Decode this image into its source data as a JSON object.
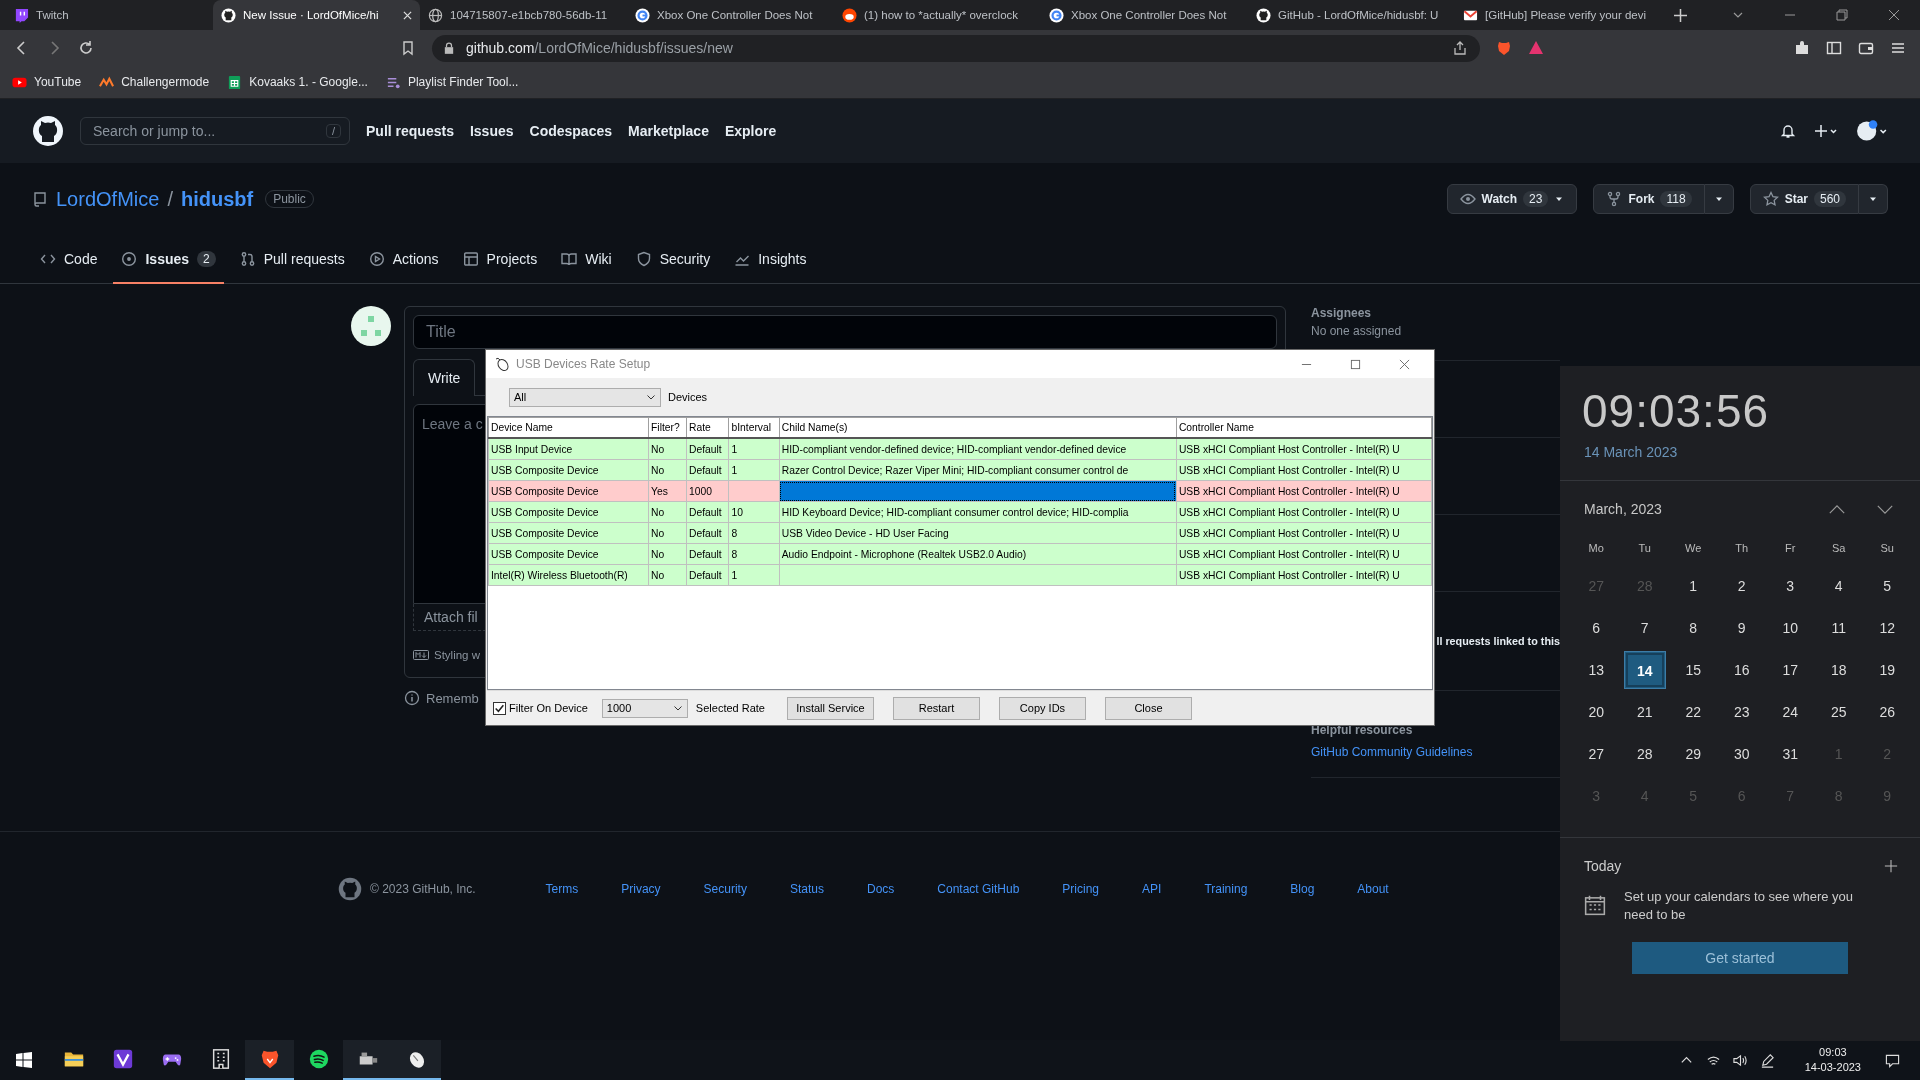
{
  "browser": {
    "tabs": [
      {
        "title": "Twitch",
        "selected": false
      },
      {
        "title": "New Issue · LordOfMice/hi",
        "selected": true
      },
      {
        "title": "104715807-e1bcb780-56db-11",
        "selected": false
      },
      {
        "title": "Xbox One Controller Does Not",
        "selected": false
      },
      {
        "title": "(1) how to *actually* overclock",
        "selected": false
      },
      {
        "title": "Xbox One Controller Does Not",
        "selected": false
      },
      {
        "title": "GitHub - LordOfMice/hidusbf: U",
        "selected": false
      },
      {
        "title": "[GitHub] Please verify your devi",
        "selected": false
      }
    ],
    "address": {
      "host": "github.com",
      "path": "/LordOfMice/hidusbf/issues/new"
    },
    "bookmarks": [
      "YouTube",
      "Challengermode",
      "Kovaaks 1. - Google...",
      "Playlist Finder Tool..."
    ]
  },
  "github": {
    "search_placeholder": "Search or jump to...",
    "search_key": "/",
    "nav": [
      "Pull requests",
      "Issues",
      "Codespaces",
      "Marketplace",
      "Explore"
    ],
    "repo": {
      "owner": "LordOfMice",
      "separator": "/",
      "name": "hidusbf",
      "visibility": "Public"
    },
    "actions": [
      {
        "label": "Watch",
        "count": "23",
        "kind": "watch"
      },
      {
        "label": "Fork",
        "count": "118",
        "kind": "fork"
      },
      {
        "label": "Star",
        "count": "560",
        "kind": "star"
      }
    ],
    "tabs": [
      {
        "label": "Code",
        "selected": false
      },
      {
        "label": "Issues",
        "count": "2",
        "selected": true
      },
      {
        "label": "Pull requests",
        "selected": false
      },
      {
        "label": "Actions",
        "selected": false
      },
      {
        "label": "Projects",
        "selected": false
      },
      {
        "label": "Wiki",
        "selected": false
      },
      {
        "label": "Security",
        "selected": false
      },
      {
        "label": "Insights",
        "selected": false
      }
    ],
    "form": {
      "title_placeholder": "Title",
      "write_tab": "Write",
      "comment_placeholder": "Leave a c",
      "attach": "Attach fil",
      "styling": "Styling w",
      "remember": "Rememb"
    },
    "sidebar": {
      "assignees_heading": "Assignees",
      "assignees_value": "No one assigned",
      "linked_note": "ll requests linked to this",
      "resources_heading": "Helpful resources",
      "resources_link": "GitHub Community Guidelines"
    },
    "footer": {
      "copyright": "© 2023 GitHub, Inc.",
      "links": [
        "Terms",
        "Privacy",
        "Security",
        "Status",
        "Docs",
        "Contact GitHub",
        "Pricing",
        "API",
        "Training",
        "Blog",
        "About"
      ]
    }
  },
  "usb_dialog": {
    "title": "USB Devices Rate Setup",
    "device_filter": "All",
    "device_filter_label": "Devices",
    "columns": [
      "Device Name",
      "Filter?",
      "Rate",
      "bInterval",
      "Child Name(s)",
      "Controller Name"
    ],
    "rows": [
      {
        "device": "USB Input Device",
        "filter": "No",
        "rate": "Default",
        "binterval": "1",
        "child": "HID-compliant vendor-defined device; HID-compliant vendor-defined device",
        "controller": "USB xHCI Compliant Host Controller - Intel(R) U",
        "color": "#ccffcc",
        "selected": false
      },
      {
        "device": "USB Composite Device",
        "filter": "No",
        "rate": "Default",
        "binterval": "1",
        "child": "Razer Control Device; Razer Viper Mini; HID-compliant consumer control de",
        "controller": "USB xHCI Compliant Host Controller - Intel(R) U",
        "color": "#ccffcc",
        "selected": false
      },
      {
        "device": "USB Composite Device",
        "filter": "Yes",
        "rate": "1000",
        "controller": "USB xHCI Compliant Host Controller - Intel(R) U",
        "color": "#ffcccc",
        "selected": true
      },
      {
        "device": "USB Composite Device",
        "filter": "No",
        "rate": "Default",
        "binterval": "10",
        "child": "HID Keyboard Device; HID-compliant consumer control device; HID-complia",
        "controller": "USB xHCI Compliant Host Controller - Intel(R) U",
        "color": "#ccffcc",
        "selected": false
      },
      {
        "device": "USB Composite Device",
        "filter": "No",
        "rate": "Default",
        "binterval": "8",
        "child": "USB Video Device - HD User Facing",
        "controller": "USB xHCI Compliant Host Controller - Intel(R) U",
        "color": "#ccffcc",
        "selected": false
      },
      {
        "device": "USB Composite Device",
        "filter": "No",
        "rate": "Default",
        "binterval": "8",
        "child": "Audio Endpoint - Microphone (Realtek USB2.0 Audio)",
        "controller": "USB xHCI Compliant Host Controller - Intel(R) U",
        "color": "#ccffcc",
        "selected": false
      },
      {
        "device": "Intel(R) Wireless Bluetooth(R)",
        "filter": "No",
        "rate": "Default",
        "binterval": "1",
        "controller": "USB xHCI Compliant Host Controller - Intel(R) U",
        "color": "#ccffcc",
        "selected": false
      }
    ],
    "filter_on_device": {
      "label": "Filter On Device",
      "checked": true
    },
    "rate_select": "1000",
    "rate_label": "Selected Rate",
    "buttons": [
      "Install Service",
      "Restart",
      "Copy IDs",
      "Close"
    ]
  },
  "calendar": {
    "time": "09:03:56",
    "date": "14 March 2023",
    "month": "March, 2023",
    "weekdays": [
      "Mo",
      "Tu",
      "We",
      "Th",
      "Fr",
      "Sa",
      "Su"
    ],
    "weeks": [
      [
        {
          "day": "27",
          "in_month": false,
          "selected": false
        },
        {
          "day": "28",
          "in_month": false,
          "selected": false
        },
        {
          "day": "1",
          "in_month": true,
          "selected": false
        },
        {
          "day": "2",
          "in_month": true,
          "selected": false
        },
        {
          "day": "3",
          "in_month": true,
          "selected": false
        },
        {
          "day": "4",
          "in_month": true,
          "selected": false
        },
        {
          "day": "5",
          "in_month": true,
          "selected": false
        }
      ],
      [
        {
          "day": "6",
          "in_month": true,
          "selected": false
        },
        {
          "day": "7",
          "in_month": true,
          "selected": false
        },
        {
          "day": "8",
          "in_month": true,
          "selected": false
        },
        {
          "day": "9",
          "in_month": true,
          "selected": false
        },
        {
          "day": "10",
          "in_month": true,
          "selected": false
        },
        {
          "day": "11",
          "in_month": true,
          "selected": false
        },
        {
          "day": "12",
          "in_month": true,
          "selected": false
        }
      ],
      [
        {
          "day": "13",
          "in_month": true,
          "selected": false
        },
        {
          "day": "14",
          "in_month": true,
          "selected": true
        },
        {
          "day": "15",
          "in_month": true,
          "selected": false
        },
        {
          "day": "16",
          "in_month": true,
          "selected": false
        },
        {
          "day": "17",
          "in_month": true,
          "selected": false
        },
        {
          "day": "18",
          "in_month": true,
          "selected": false
        },
        {
          "day": "19",
          "in_month": true,
          "selected": false
        }
      ],
      [
        {
          "day": "20",
          "in_month": true,
          "selected": false
        },
        {
          "day": "21",
          "in_month": true,
          "selected": false
        },
        {
          "day": "22",
          "in_month": true,
          "selected": false
        },
        {
          "day": "23",
          "in_month": true,
          "selected": false
        },
        {
          "day": "24",
          "in_month": true,
          "selected": false
        },
        {
          "day": "25",
          "in_month": true,
          "selected": false
        },
        {
          "day": "26",
          "in_month": true,
          "selected": false
        }
      ],
      [
        {
          "day": "27",
          "in_month": true,
          "selected": false
        },
        {
          "day": "28",
          "in_month": true,
          "selected": false
        },
        {
          "day": "29",
          "in_month": true,
          "selected": false
        },
        {
          "day": "30",
          "in_month": true,
          "selected": false
        },
        {
          "day": "31",
          "in_month": true,
          "selected": false
        },
        {
          "day": "1",
          "in_month": false,
          "selected": false
        },
        {
          "day": "2",
          "in_month": false,
          "selected": false
        }
      ],
      [
        {
          "day": "3",
          "in_month": false,
          "selected": false
        },
        {
          "day": "4",
          "in_month": false,
          "selected": false
        },
        {
          "day": "5",
          "in_month": false,
          "selected": false
        },
        {
          "day": "6",
          "in_month": false,
          "selected": false
        },
        {
          "day": "7",
          "in_month": false,
          "selected": false
        },
        {
          "day": "8",
          "in_month": false,
          "selected": false
        },
        {
          "day": "9",
          "in_month": false,
          "selected": false
        }
      ]
    ],
    "today": "Today",
    "setup_text": "Set up your calendars to see where you need to be",
    "button": "Get started"
  },
  "taskbar": {
    "apps": [
      {
        "running": false
      },
      {
        "running": false
      },
      {
        "running": false
      },
      {
        "running": false
      },
      {
        "running": true
      },
      {
        "running": false
      },
      {
        "running": true
      },
      {
        "running": true
      }
    ],
    "time": "09:03",
    "date": "14-03-2023"
  }
}
